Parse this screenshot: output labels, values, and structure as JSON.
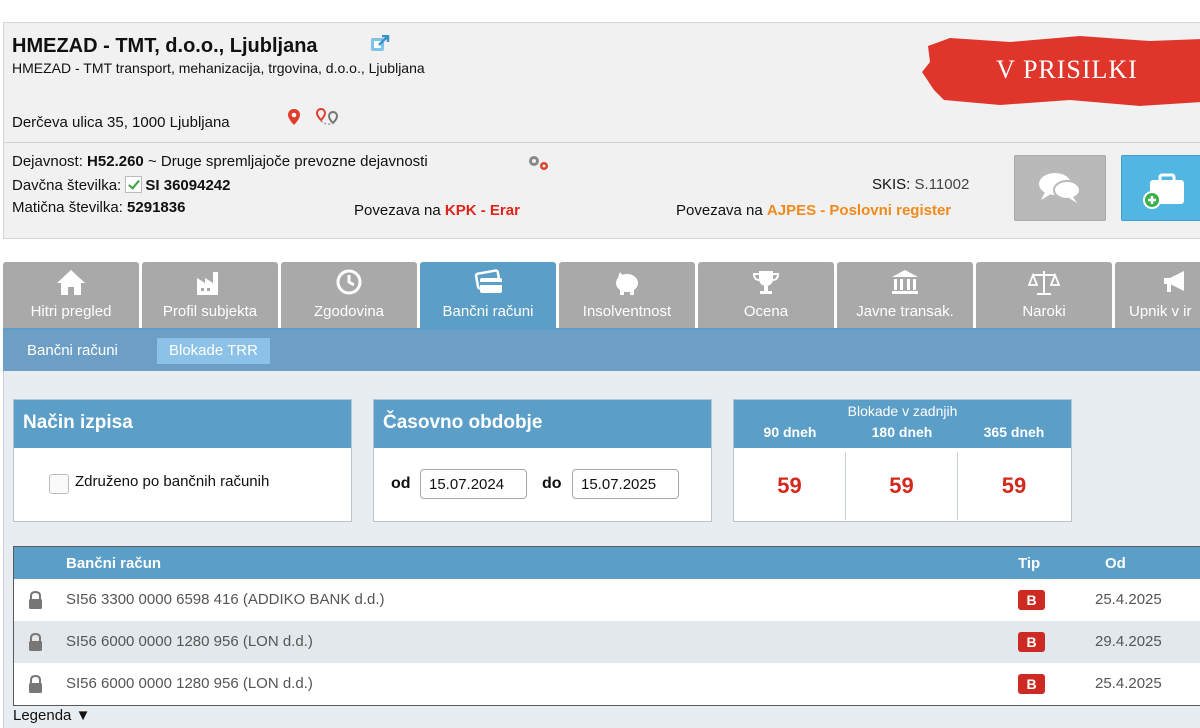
{
  "company": {
    "name": "HMEZAD - TMT, d.o.o., Ljubljana",
    "full_name": "HMEZAD - TMT transport, mehanizacija, trgovina, d.o.o., Ljubljana",
    "address": "Derčeva ulica 35, 1000 Ljubljana",
    "status": "V PRISILKI"
  },
  "info": {
    "activity_label": "Dejavnost:",
    "activity_code": "H52.260",
    "activity_desc": "~ Druge spremljajoče prevozne dejavnosti",
    "tax_label": "Davčna številka:",
    "tax_number": "SI 36094242",
    "reg_label": "Matična številka:",
    "reg_number": "5291836",
    "kpk_prefix": "Povezava na",
    "kpk_link": "KPK - Erar",
    "skis_label": "SKIS:",
    "skis_value": "S.11002",
    "ajpes_prefix": "Povezava na",
    "ajpes_link": "AJPES - Poslovni register"
  },
  "tabs": [
    {
      "label": "Hitri pregled",
      "icon": "home-icon"
    },
    {
      "label": "Profil subjekta",
      "icon": "factory-icon"
    },
    {
      "label": "Zgodovina",
      "icon": "clock-icon"
    },
    {
      "label": "Bančni računi",
      "icon": "card-icon"
    },
    {
      "label": "Insolventnost",
      "icon": "piggy-bank-icon"
    },
    {
      "label": "Ocena",
      "icon": "trophy-icon"
    },
    {
      "label": "Javne transak.",
      "icon": "bank-building-icon"
    },
    {
      "label": "Naroki",
      "icon": "scales-icon"
    },
    {
      "label": "Upnik v ir",
      "icon": "megaphone-icon"
    }
  ],
  "subtabs": [
    {
      "label": "Bančni računi"
    },
    {
      "label": "Blokade TRR"
    }
  ],
  "panels": {
    "mode_title": "Način izpisa",
    "mode_checkbox_label": "Združeno po bančnih računih",
    "period_title": "Časovno obdobje",
    "from_label": "od",
    "from_value": "15.07.2024",
    "to_label": "do",
    "to_value": "15.07.2025",
    "blockades_title": "Blokade v zadnjih",
    "blockades": [
      {
        "label": "90 dneh",
        "value": "59"
      },
      {
        "label": "180 dneh",
        "value": "59"
      },
      {
        "label": "365 dneh",
        "value": "59"
      }
    ]
  },
  "table": {
    "headers": {
      "account": "Bančni račun",
      "type": "Tip",
      "from": "Od"
    },
    "rows": [
      {
        "account": "SI56 3300 0000 6598 416 (ADDIKO BANK d.d.)",
        "type": "B",
        "from": "25.4.2025"
      },
      {
        "account": "SI56 6000 0000 1280 956 (LON d.d.)",
        "type": "B",
        "from": "29.4.2025"
      },
      {
        "account": "SI56 6000 0000 1280 956 (LON d.d.)",
        "type": "B",
        "from": "25.4.2025"
      }
    ]
  },
  "legend": "Legenda ▼",
  "colors": {
    "primary": "#5b9ec8",
    "status_red": "#e0352b",
    "badge_red": "#cc2a22",
    "value_red": "#d32a1e"
  }
}
